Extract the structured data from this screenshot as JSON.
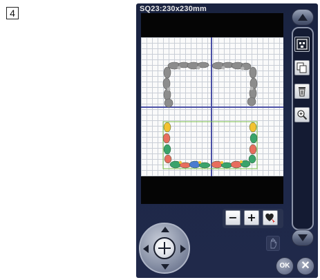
{
  "step": {
    "number": "4"
  },
  "hoop": {
    "label": "SQ23:230x230mm"
  },
  "side_toolbar": {
    "icons": [
      "multi-select-icon",
      "duplicate-icon",
      "delete-icon",
      "zoom-in-icon"
    ],
    "scroll_up": "triangle-up-icon",
    "scroll_down": "triangle-down-icon"
  },
  "mini_toolbar": {
    "minus_label": "−",
    "plus_label": "+",
    "heart_icon": "heart-pointer-icon"
  },
  "navigation": {
    "dpad": "move-dpad",
    "center_icon": "move-center-icon",
    "hand_icon": "hand-icon"
  },
  "actions": {
    "ok_label": "OK",
    "close_label": "✕"
  },
  "colors": {
    "device_bg": "#1d2848",
    "grid_bg": "#fafafa",
    "grid_line": "#c9ced6",
    "axis": "#4a50a6",
    "design_gray": "#8c8c8c",
    "leaf_green": "#3aa36b",
    "leaf_coral": "#e86d5e",
    "leaf_yellow": "#f2c230",
    "leaf_blue": "#4a7bd0",
    "hoop_outline": "#7cc24a"
  }
}
